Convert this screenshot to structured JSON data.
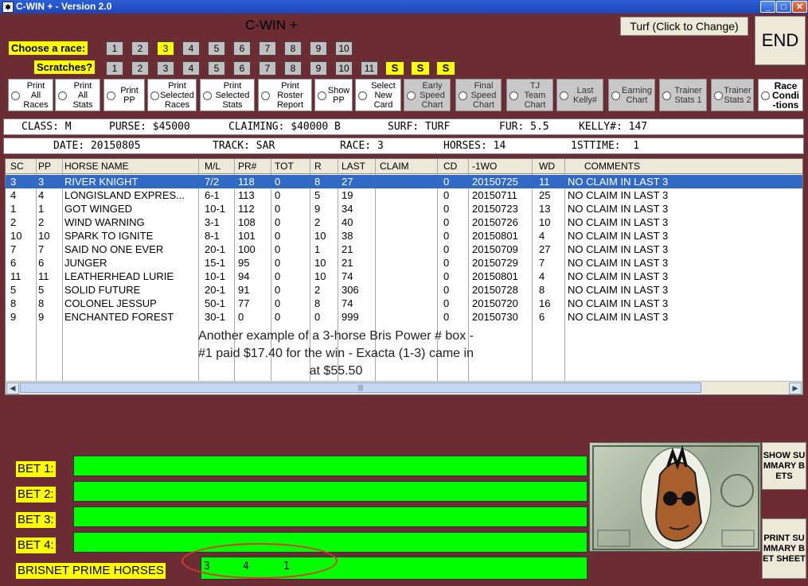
{
  "window": {
    "title": "C-WIN + - Version 2.0",
    "app_heading": "C-WIN +"
  },
  "top": {
    "turf_button": "Turf (Click to Change)",
    "end_button": "END"
  },
  "race_selector": {
    "label": "Choose  a race:",
    "races": [
      "1",
      "2",
      "3",
      "4",
      "5",
      "6",
      "7",
      "8",
      "9",
      "10"
    ],
    "selected": "3"
  },
  "scratches": {
    "label": "Scratches?",
    "numbers": [
      "1",
      "2",
      "3",
      "4",
      "5",
      "6",
      "7",
      "8",
      "9",
      "10",
      "11"
    ],
    "s_buttons": [
      "S",
      "S",
      "S"
    ]
  },
  "options": [
    "Print\nAll\nRaces",
    "Print\nAll\nStats",
    "Print\nPP",
    "Print\nSelected\nRaces",
    "Print\nSelected\nStats",
    "Print\nRoster\nReport",
    "Show\nPP",
    "Select\nNew\nCard",
    "Early\nSpeed\nChart",
    "Final\nSpeed\nChart",
    "TJ\nTeam\nChart",
    "Last\nKelly#",
    "Earning\nChart",
    "Trainer\nStats 1",
    "Trainer\nStats 2",
    "Race\nCondi\n-tions"
  ],
  "info": {
    "class": "CLASS: M",
    "purse": "PURSE: $45000",
    "claiming": "CLAIMING: $40000 B",
    "surf": "SURF: TURF",
    "fur": "FUR: 5.5",
    "kelly": "KELLY#: 147",
    "date": "DATE: 20150805",
    "track": "TRACK: SAR",
    "race": "RACE: 3",
    "horses": "HORSES: 14",
    "firsttime": "1STTIME:  1"
  },
  "table": {
    "headers": [
      "SC",
      "PP",
      "HORSE NAME",
      "M/L",
      "PR#",
      "TOT",
      "R",
      "LAST",
      "CLAIM",
      "CD",
      "-1WO",
      "WD",
      "COMMENTS"
    ],
    "rows": [
      [
        "3",
        "3",
        "RIVER KNIGHT",
        "7/2",
        "118",
        "0",
        "8",
        "27",
        "",
        "0",
        "20150725",
        "11",
        "NO CLAIM IN LAST 3"
      ],
      [
        "4",
        "4",
        "LONGISLAND EXPRES...",
        "6-1",
        "113",
        "0",
        "5",
        "19",
        "",
        "0",
        "20150711",
        "25",
        "NO CLAIM IN LAST 3"
      ],
      [
        "1",
        "1",
        "GOT WINGED",
        "10-1",
        "112",
        "0",
        "9",
        "34",
        "",
        "0",
        "20150723",
        "13",
        "NO CLAIM IN LAST 3"
      ],
      [
        "2",
        "2",
        "WIND WARNING",
        "3-1",
        "108",
        "0",
        "2",
        "40",
        "",
        "0",
        "20150726",
        "10",
        "NO CLAIM IN LAST 3"
      ],
      [
        "10",
        "10",
        "SPARK TO IGNITE",
        "8-1",
        "101",
        "0",
        "10",
        "38",
        "",
        "0",
        "20150801",
        "4",
        "NO CLAIM IN LAST 3"
      ],
      [
        "7",
        "7",
        "SAID NO ONE EVER",
        "20-1",
        "100",
        "0",
        "1",
        "21",
        "",
        "0",
        "20150709",
        "27",
        "NO CLAIM IN LAST 3"
      ],
      [
        "6",
        "6",
        "JUNGER",
        "15-1",
        "95",
        "0",
        "10",
        "21",
        "",
        "0",
        "20150729",
        "7",
        "NO CLAIM IN LAST 3"
      ],
      [
        "11",
        "11",
        "LEATHERHEAD LURIE",
        "10-1",
        "94",
        "0",
        "10",
        "74",
        "",
        "0",
        "20150801",
        "4",
        "NO CLAIM IN LAST 3"
      ],
      [
        "5",
        "5",
        "SOLID FUTURE",
        "20-1",
        "91",
        "0",
        "2",
        "306",
        "",
        "0",
        "20150728",
        "8",
        "NO CLAIM IN LAST 3"
      ],
      [
        "8",
        "8",
        "COLONEL JESSUP",
        "50-1",
        "77",
        "0",
        "8",
        "74",
        "",
        "0",
        "20150720",
        "16",
        "NO CLAIM IN LAST 3"
      ],
      [
        "9",
        "9",
        "ENCHANTED FOREST",
        "30-1",
        "0",
        "0",
        "0",
        "999",
        "",
        "0",
        "20150730",
        "6",
        "NO CLAIM IN LAST 3"
      ]
    ]
  },
  "annotation": "Another example of a 3-horse Bris Power # box - #1 paid $17.40 for the win - Exacta (1-3) came in at $55.50",
  "bets": {
    "labels": [
      "BET 1:",
      "BET 2:",
      "BET 3:",
      "BET 4:"
    ],
    "prime_label": "BRISNET PRIME HORSES",
    "prime_values": [
      "3",
      "4",
      "1"
    ]
  },
  "side_buttons": {
    "summary": "SHOW SUMMARY BETS",
    "print": "PRINT SUMMARY BET SHEET"
  }
}
